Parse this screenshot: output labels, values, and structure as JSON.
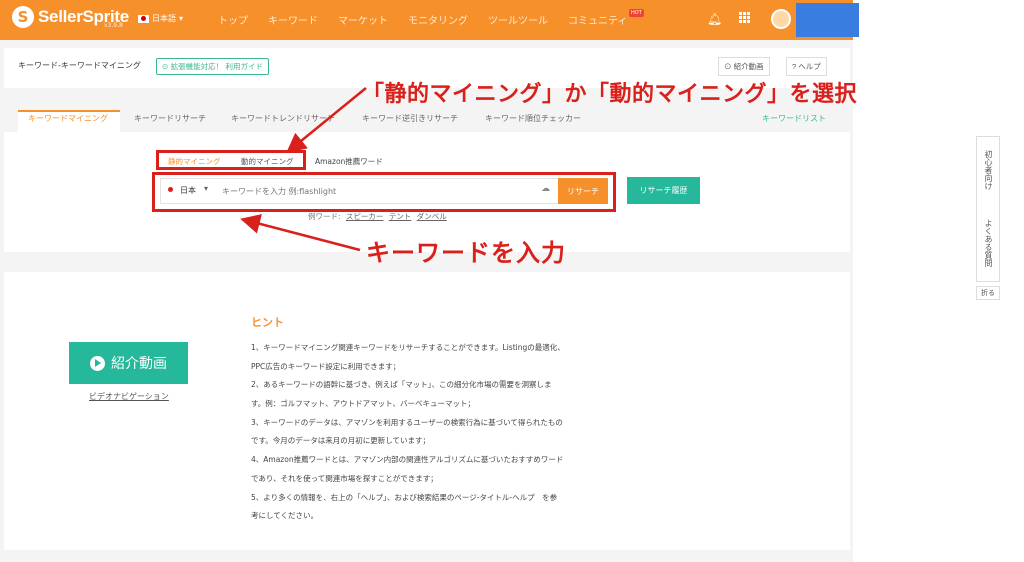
{
  "nav": {
    "logo_text": "SellerSprite",
    "version": "v3.9.8",
    "language": "日本語",
    "items": [
      "トップ",
      "キーワード",
      "マーケット",
      "モニタリング",
      "ツールツール",
      "コミュニティ"
    ],
    "hot_badge": "HOT"
  },
  "header": {
    "breadcrumb": "キーワード-キーワードマイニング",
    "guide_label": "拡張機能対応！ 利用ガイド",
    "video_button": "紹介動画",
    "help_button": "ヘルプ"
  },
  "tabs": [
    "キーワードマイニング",
    "キーワードリサーチ",
    "キーワードトレンドリサーチ",
    "キーワード逆引きリサーチ",
    "キーワード順位チェッカー"
  ],
  "tab_right": "キーワードリスト",
  "search": {
    "modes": [
      "静的マイニング",
      "動的マイニング"
    ],
    "amazon_mode": "Amazon推薦ワード",
    "country": "日本",
    "placeholder": "キーワードを入力 例:flashlight",
    "research_button": "リサーチ",
    "history_button": "リサーチ履歴",
    "examples_label": "例ワード:",
    "examples": [
      "スピーカー",
      "テント",
      "ダンベル"
    ]
  },
  "intro": {
    "button_label": "紹介動画",
    "video_nav_link": "ビデオナビゲーション"
  },
  "hint": {
    "title": "ヒント",
    "lines": [
      "1、キーワードマイニング関連キーワードをリサーチすることができます。Listingの最適化、",
      "PPC広告のキーワード設定に利用できます；",
      "2、あるキーワードの語幹に基づき、例えば「マット」、この細分化市場の需要を洞察しま",
      "す。例：ゴルフマット、アウトドアマット、バーベキューマット；",
      "3、キーワードのデータは、アマゾンを利用するユーザーの検索行為に基づいて得られたもの",
      "です。今月のデータは来月の月初に更新しています；",
      "4、Amazon推薦ワードとは、アマゾン内部の関連性アルゴリズムに基づいたおすすめワード",
      "であり、それを使って関連市場を探すことができます；",
      "5、より多くの情報を、右上の「ヘルプ」、および検索結果のページ-タイトル-ヘルプ　を参",
      "考にしてください。"
    ]
  },
  "rail": {
    "beginner": "初心者向け",
    "faq": "よくある質問",
    "fold": "折る"
  },
  "annotations": {
    "top": "「静的マイニング」か「動的マイニング」を選択",
    "bottom": "キーワードを入力"
  },
  "colors": {
    "brand_orange": "#f6902b",
    "accent_green": "#26b89a",
    "annotation_red": "#d9201b"
  }
}
